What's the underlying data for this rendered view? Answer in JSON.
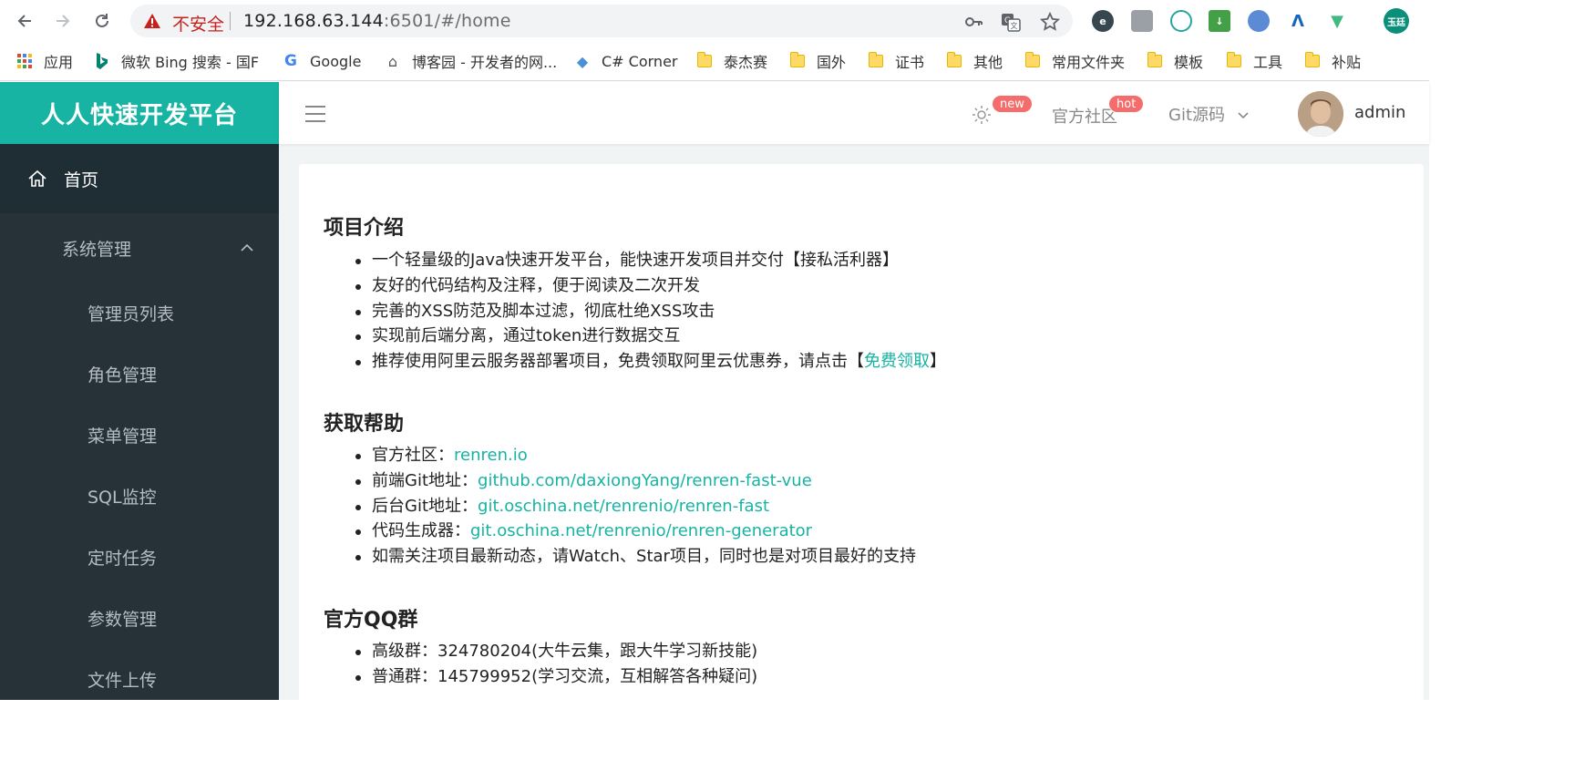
{
  "browser": {
    "not_secure": "不安全",
    "url_host": "192.168.63.144",
    "url_rest": ":6501/#/home",
    "profile_initials": "玉廷"
  },
  "bookmarks": [
    {
      "label": "应用",
      "icon": "apps-grid-icon"
    },
    {
      "label": "微软 Bing 搜索 - 国F",
      "icon": "bing-icon"
    },
    {
      "label": "Google",
      "icon": "google-icon"
    },
    {
      "label": "博客园 - 开发者的网...",
      "icon": "cnblogs-icon"
    },
    {
      "label": "C# Corner",
      "icon": "csharp-corner-icon"
    },
    {
      "label": "泰杰赛",
      "icon": "folder-icon"
    },
    {
      "label": "国外",
      "icon": "folder-icon"
    },
    {
      "label": "证书",
      "icon": "folder-icon"
    },
    {
      "label": "其他",
      "icon": "folder-icon"
    },
    {
      "label": "常用文件夹",
      "icon": "folder-icon"
    },
    {
      "label": "模板",
      "icon": "folder-icon"
    },
    {
      "label": "工具",
      "icon": "folder-icon"
    },
    {
      "label": "补贴",
      "icon": "folder-icon"
    }
  ],
  "app": {
    "brand": "人人快速开发平台",
    "sidebar": {
      "home": "首页",
      "group": "系统管理",
      "items": [
        "管理员列表",
        "角色管理",
        "菜单管理",
        "SQL监控",
        "定时任务",
        "参数管理",
        "文件上传"
      ]
    },
    "topbar": {
      "badge_new": "new",
      "community": "官方社区",
      "badge_hot": "hot",
      "git": "Git源码",
      "username": "admin"
    }
  },
  "content": {
    "section1": {
      "title": "项目介绍",
      "items": [
        "一个轻量级的Java快速开发平台，能快速开发项目并交付【接私活利器】",
        "友好的代码结构及注释，便于阅读及二次开发",
        "完善的XSS防范及脚本过滤，彻底杜绝XSS攻击",
        "实现前后端分离，通过token进行数据交互"
      ],
      "last_prefix": "推荐使用阿里云服务器部署项目，免费领取阿里云优惠券，请点击【",
      "last_link": "免费领取",
      "last_suffix": "】"
    },
    "section2": {
      "title": "获取帮助",
      "links": [
        {
          "label": "官方社区：",
          "link": "renren.io"
        },
        {
          "label": "前端Git地址：",
          "link": "github.com/daxiongYang/renren-fast-vue"
        },
        {
          "label": "后台Git地址：",
          "link": "git.oschina.net/renrenio/renren-fast"
        },
        {
          "label": "代码生成器：",
          "link": "git.oschina.net/renrenio/renren-generator"
        }
      ],
      "last": "如需关注项目最新动态，请Watch、Star项目，同时也是对项目最好的支持"
    },
    "section3": {
      "title": "官方QQ群",
      "items": [
        "高级群：324780204(大牛云集，跟大牛学习新技能)",
        "普通群：145799952(学习交流，互相解答各种疑问)"
      ]
    }
  }
}
